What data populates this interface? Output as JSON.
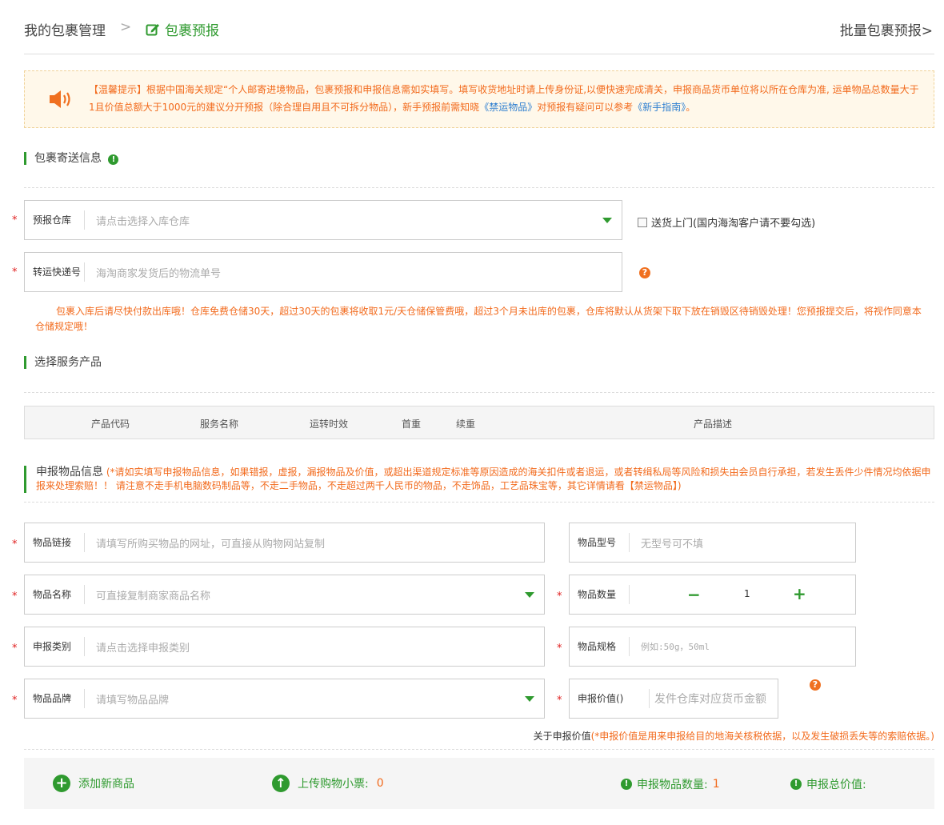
{
  "header": {
    "breadcrumb_root": "我的包裹管理",
    "breadcrumb_sep": ">",
    "breadcrumb_current": "包裹预报",
    "batch_link": "批量包裹预报>"
  },
  "notice": {
    "text_a": "【温馨提示】根据中国海关规定“个人邮寄进境物品，包裹预报和申报信息需如实填写。填写收货地址时请上传身份证,以便快速完成清关，申报商品货币单位将以所在仓库为准, 运单物品总数量大于1且价值总额大于1000元的建议分开预报（除合理自用且不可拆分物品），新手预报前需知晓",
    "link_banned": "《禁运物品》",
    "text_b": "对预报有疑问可以参考",
    "link_guide": "《新手指南》",
    "text_c": "。"
  },
  "section_shipping": {
    "title": "包裹寄送信息"
  },
  "warehouse": {
    "label": "预报仓库",
    "placeholder": "请点击选择入库仓库"
  },
  "delivery": {
    "label": "送货上门(国内海淘客户请不要勾选)"
  },
  "tracking": {
    "label": "转运快递号",
    "placeholder": "海淘商家发货后的物流单号"
  },
  "storage_notice": "包裹入库后请尽快付款出库哦！仓库免费仓储30天，超过30天的包裹将收取1元/天仓储保管费哦，超过3个月未出库的包裹，仓库将默认从货架下取下放在销毁区待销毁处理！您预报提交后，将视作同意本仓储规定哦！",
  "section_service": {
    "title": "选择服务产品"
  },
  "service_table": {
    "headers": [
      "产品代码",
      "服务名称",
      "运转时效",
      "首重",
      "续重",
      "产品描述"
    ]
  },
  "section_declare": {
    "title": "申报物品信息",
    "note": "(*请如实填写申报物品信息，如果错报，虚报，漏报物品及价值，或超出渠道规定标准等原因造成的海关扣件或者退运，或者转缉私局等风险和损失由会员自行承担，若发生丢件少件情况均依据申报来处理索赔！！ 请注意不走手机电脑数码制品等，不走二手物品，不走超过两千人民币的物品，不走饰品，工艺品珠宝等，其它详情请看【禁运物品】)"
  },
  "item_link": {
    "label": "物品链接",
    "placeholder": "请填写所购买物品的网址，可直接从购物网站复制"
  },
  "item_model": {
    "label": "物品型号",
    "placeholder": "无型号可不填"
  },
  "item_name": {
    "label": "物品名称",
    "placeholder": "可直接复制商家商品名称"
  },
  "item_qty": {
    "label": "物品数量",
    "minus": "−",
    "value": "1",
    "plus": "+"
  },
  "declare_category": {
    "label": "申报类别",
    "placeholder": "请点击选择申报类别"
  },
  "item_spec": {
    "label": "物品规格",
    "placeholder": "例如:50g，50ml"
  },
  "item_brand": {
    "label": "物品品牌",
    "placeholder": "请填写物品品牌"
  },
  "declare_value": {
    "label": "申报价值()",
    "placeholder": "发件仓库对应货币金额"
  },
  "value_note": {
    "prefix": "关于申报价值",
    "text": "(*申报价值是用来申报给目的地海关核税依据，以及发生破损丢失等的索赔依据。)"
  },
  "bottom": {
    "add_item": "添加新商品",
    "upload_receipt": "上传购物小票:",
    "receipt_count": "0",
    "declared_qty_label": "申报物品数量:",
    "declared_qty": "1",
    "declared_total_label": "申报总价值:"
  },
  "colors": {
    "accent": "#2f9a2f",
    "warning": "#f26a1c",
    "link": "#2f7fd0"
  }
}
